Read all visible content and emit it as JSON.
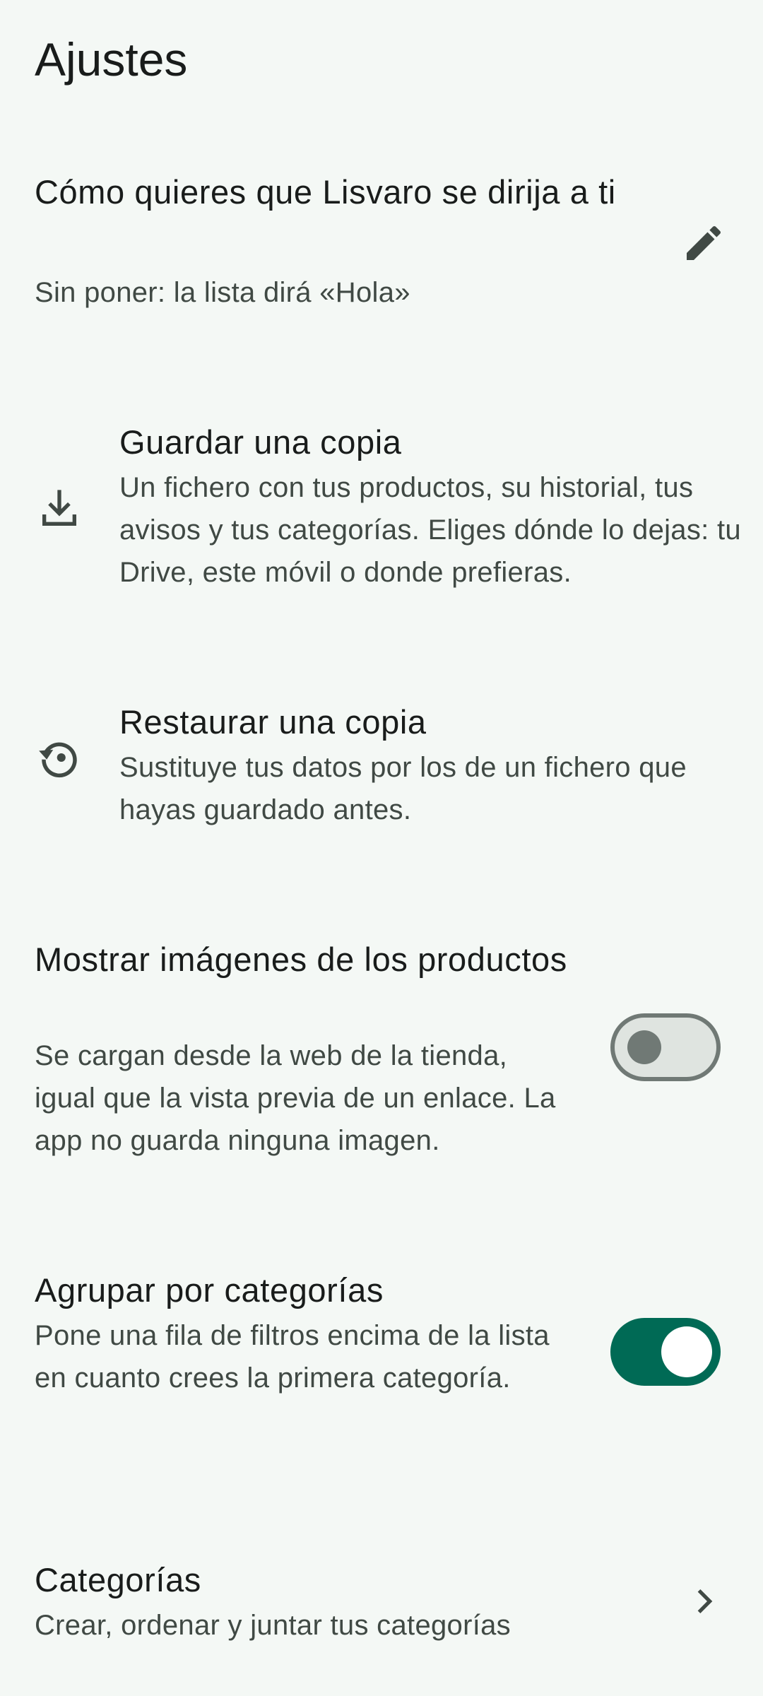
{
  "header": {
    "title": "Ajustes"
  },
  "settings": {
    "name": {
      "title": "Cómo quieres que Lisvaro se dirija a ti",
      "subtitle": "Sin poner: la lista dirá «Hola»",
      "icon": "pencil-icon"
    },
    "backup": {
      "title": "Guardar una copia",
      "subtitle": "Un fichero con tus productos, su historial, tus avisos y tus categorías. Eliges dónde lo dejas: tu Drive, este móvil o donde prefieras.",
      "icon": "download-icon"
    },
    "restore": {
      "title": "Restaurar una copia",
      "subtitle": "Sustituye tus datos por los de un fichero que hayas guardado antes.",
      "icon": "restore-icon"
    },
    "images": {
      "title": "Mostrar imágenes de los productos",
      "subtitle": "Se cargan desde la web de la tienda, igual que la vista previa de un enlace. La app no guarda ninguna imagen.",
      "enabled": false
    },
    "group": {
      "title": "Agrupar por categorías",
      "subtitle": "Pone una fila de filtros encima de la lista en cuanto crees la primera categoría.",
      "enabled": true
    },
    "categories": {
      "title": "Categorías",
      "subtitle": "Crear, ordenar y juntar tus categorías",
      "icon": "chevron-right-icon"
    }
  },
  "colors": {
    "background": "#f4f8f5",
    "accent": "#006a55",
    "switch_off_track": "#dfe4e0",
    "switch_off_outline": "#707975",
    "text_primary": "#191c1b",
    "text_secondary": "#404944"
  }
}
